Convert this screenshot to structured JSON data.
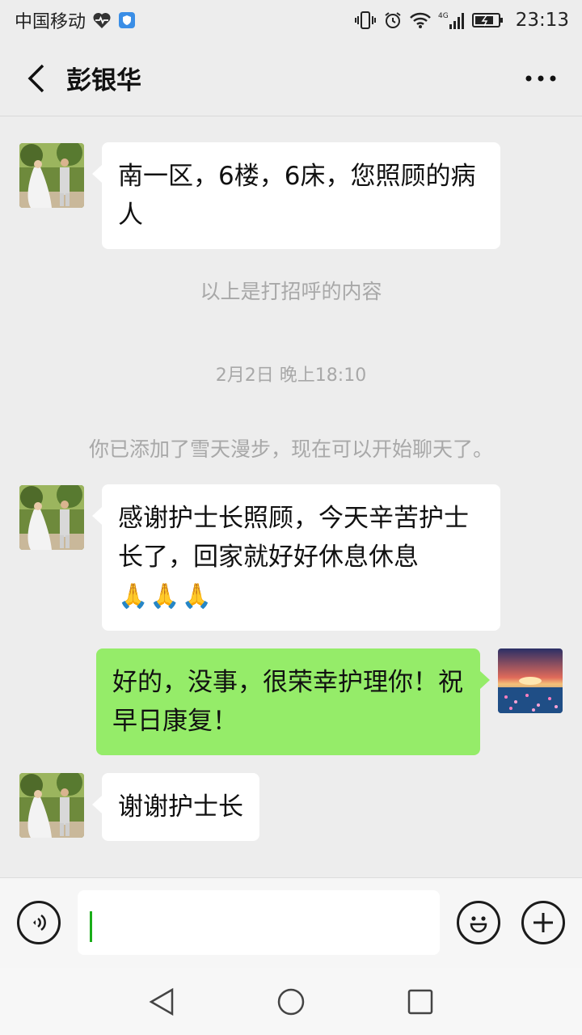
{
  "status_bar": {
    "carrier": "中国移动",
    "network": "4G",
    "time": "23:13",
    "icons": [
      "heart-pulse-icon",
      "shield-icon",
      "vibrate-icon",
      "alarm-icon",
      "wifi-icon",
      "signal-icon",
      "battery-icon"
    ]
  },
  "header": {
    "title": "彭银华",
    "back_icon": "back-chevron-icon",
    "more_icon": "more-dots-icon"
  },
  "messages": [
    {
      "type": "incoming",
      "text": "南一区，6楼，6床，您照顾的病人"
    },
    {
      "type": "system",
      "text": "以上是打招呼的内容"
    },
    {
      "type": "timestamp",
      "text": "2月2日 晚上18:10"
    },
    {
      "type": "system",
      "text": "你已添加了雪天漫步，现在可以开始聊天了。"
    },
    {
      "type": "incoming",
      "text": "感谢护士长照顾，今天辛苦护士长了，回家就好好休息休息",
      "emoji": "🙏🙏🙏"
    },
    {
      "type": "outgoing",
      "text": "好的，没事，很荣幸护理你！祝早日康复！"
    },
    {
      "type": "incoming",
      "text": "谢谢护士长"
    }
  ],
  "input_bar": {
    "value": "",
    "icons": [
      "voice-icon",
      "emoji-icon",
      "add-icon"
    ]
  },
  "system_nav": {
    "icons": [
      "nav-back-icon",
      "nav-home-icon",
      "nav-recent-icon"
    ]
  },
  "colors": {
    "background": "#ededed",
    "outgoing_bubble": "#95ec69",
    "incoming_bubble": "#ffffff",
    "system_text": "#a8a8a8",
    "caret": "#1aad19"
  }
}
